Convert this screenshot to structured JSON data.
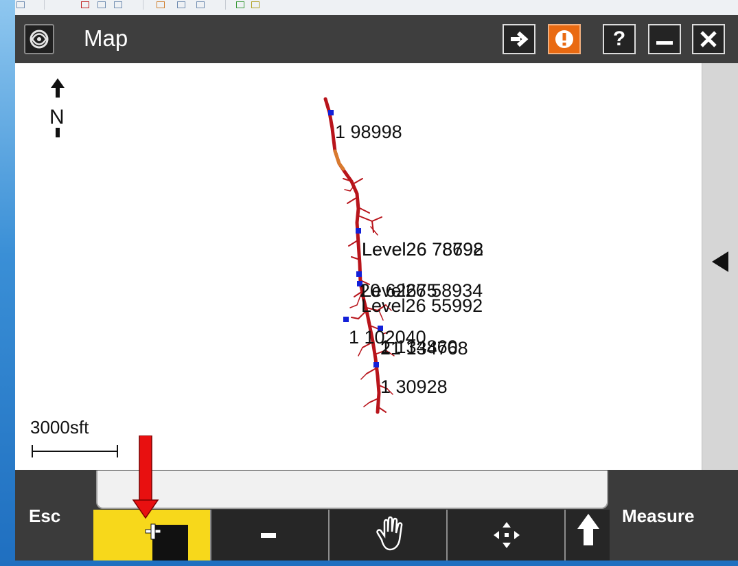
{
  "window": {
    "title": "Map"
  },
  "icons": {
    "app_logo": "app-logo-icon",
    "login": "sign-in-arrow-icon",
    "alert": "exclamation-alert-icon",
    "help": "question-mark-icon",
    "minimize": "minimize-icon",
    "close": "close-icon",
    "north": "north-arrow-icon",
    "panel": "triangle-left-icon",
    "zoom_in": "zoom-in-icon",
    "zoom_out": "minus-icon",
    "pan": "hand-icon",
    "zoom_extents": "four-arrows-icon",
    "up": "up-arrow-icon"
  },
  "titlebar": {
    "help_label": "?"
  },
  "map": {
    "north_label": "N",
    "scale_label": "3000sft",
    "points": [
      {
        "label": "1 98998"
      },
      {
        "label": "Level26 78798"
      },
      {
        "label": "Level26 78692"
      },
      {
        "label": "20 62675"
      },
      {
        "label": "Level26 58934"
      },
      {
        "label": "Level26 55992"
      },
      {
        "label": "1 102040"
      },
      {
        "label": "1 134860"
      },
      {
        "label": "21 134768"
      },
      {
        "label": "1 30928"
      }
    ]
  },
  "toolbar": {
    "esc_label": "Esc",
    "measure_label": "Measure",
    "status_text": ""
  },
  "colors": {
    "titlebar": "#3e3e3e",
    "alert_button": "#e96a12",
    "selected_tool": "#f7d81b",
    "trace_line": "#b8141b",
    "trace_segment": "#d87a2e",
    "point_marker": "#1320d8",
    "annotation_arrow": "#e81010"
  }
}
